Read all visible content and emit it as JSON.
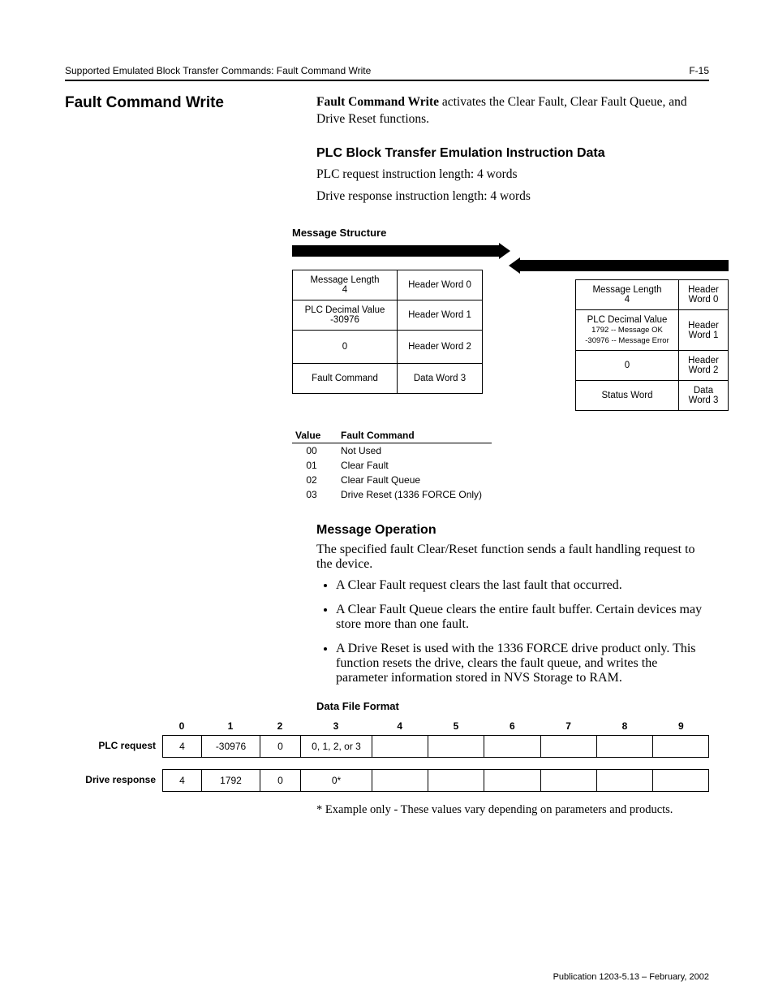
{
  "header": {
    "breadcrumb": "Supported Emulated Block Transfer Commands: Fault Command Write",
    "page_num": "F-15"
  },
  "sidebar": {
    "title": "Fault Command Write"
  },
  "intro": {
    "lead": "Fault Command Write",
    "rest": " activates the Clear Fault, Clear Fault Queue, and Drive Reset functions."
  },
  "plc_h": "PLC Block Transfer Emulation Instruction Data",
  "plc_req": "PLC request instruction length: 4 words",
  "plc_resp": "Drive response instruction length: 4 words",
  "msg_struct_h": "Message Structure",
  "diagram": {
    "left": {
      "r1a": "Message Length",
      "r1b": "4",
      "r1c": "Header Word 0",
      "r2a": "PLC Decimal Value",
      "r2b": "-30976",
      "r2c": "Header Word 1",
      "r3a": "0",
      "r3c": "Header Word 2",
      "r4a": "Fault Command",
      "r4c": "Data Word 3"
    },
    "right": {
      "r1a": "Message Length",
      "r1b": "4",
      "r1c": "Header Word 0",
      "r2a": "PLC Decimal Value",
      "r2b": "1792 -- Message OK",
      "r2b2": "-30976 -- Message Error",
      "r2c": "Header Word 1",
      "r3a": "0",
      "r3c": "Header Word 2",
      "r4a": "Status Word",
      "r4c": "Data Word 3"
    }
  },
  "vf": {
    "h1": "Value",
    "h2": "Fault Command",
    "rows": [
      {
        "v": "00",
        "c": "Not Used"
      },
      {
        "v": "01",
        "c": "Clear Fault"
      },
      {
        "v": "02",
        "c": "Clear Fault Queue"
      },
      {
        "v": "03",
        "c": "Drive Reset (1336 FORCE Only)"
      }
    ]
  },
  "msg_op_h": "Message Operation",
  "msg_op_p": "The specified fault Clear/Reset function sends a fault handling request to the device.",
  "bullets": [
    "A Clear Fault request clears the last fault that occurred.",
    "A Clear Fault Queue clears the entire fault buffer. Certain devices may store more than one fault.",
    "A Drive Reset is used with the 1336 FORCE drive product only. This function resets the drive, clears the fault queue, and writes the parameter information stored in NVS Storage to RAM."
  ],
  "dff_h": "Data File Format",
  "dff": {
    "cols": [
      "0",
      "1",
      "2",
      "3",
      "4",
      "5",
      "6",
      "7",
      "8",
      "9"
    ],
    "plc_label": "PLC request",
    "plc": [
      "4",
      "-30976",
      "0",
      "0, 1, 2, or 3",
      "",
      "",
      "",
      "",
      "",
      ""
    ],
    "drv_label": "Drive response",
    "drv": [
      "4",
      "1792",
      "0",
      "0*",
      "",
      "",
      "",
      "",
      "",
      ""
    ]
  },
  "footnote": "* Example only - These values vary depending on parameters and products.",
  "pub": "Publication 1203-5.13 – February, 2002"
}
